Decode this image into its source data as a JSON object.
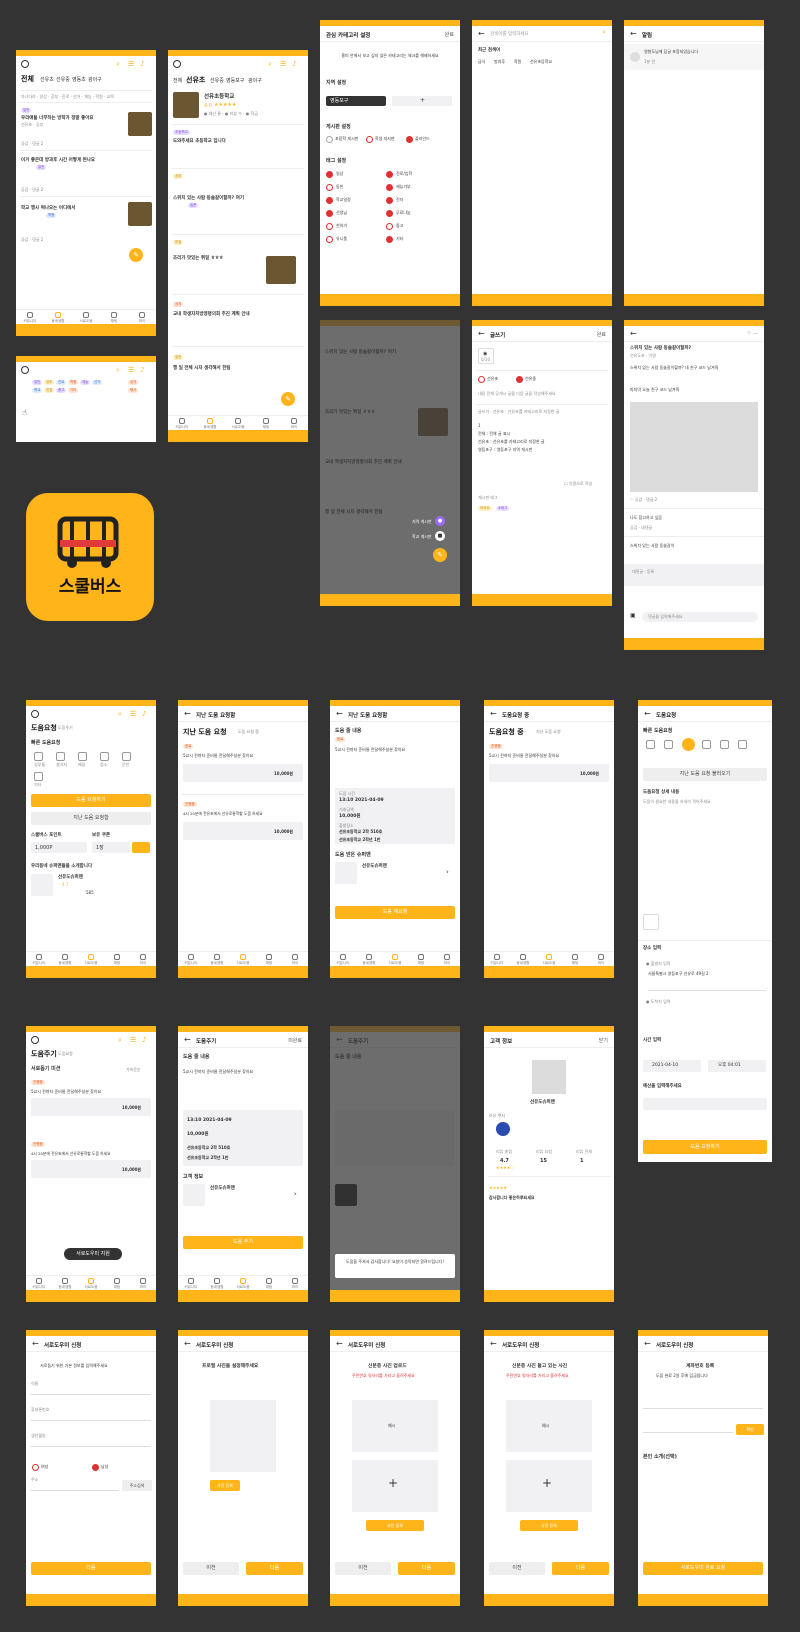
{
  "app": {
    "name": "스쿨버스",
    "accent": "#FFB41A",
    "background": "#333333"
  },
  "home": {
    "region_tabs": [
      "전체",
      "선유초",
      "선유중",
      "영동초",
      "광이구"
    ],
    "posts": [
      {
        "title": "우리애들 너무하는 방학가 정말 좋아요",
        "meta": "공감 · 댓글 2"
      },
      {
        "title": "이거 좋은데 방과후 시간 어떻게 된나요",
        "meta": "공감 · 댓글 2"
      },
      {
        "title": "학교 행사 떡나오는 어디에서",
        "meta": "공감 · 댓글 2"
      }
    ]
  },
  "school": {
    "tabs": [
      "전체",
      "선유초",
      "선유중",
      "영등포구",
      "광이구"
    ],
    "school_name": "선유초등학교",
    "rating": "4.0",
    "posts": [
      {
        "tag": "초등학교",
        "title": "도와주세요 초등학교 입니다"
      },
      {
        "tag": "공부",
        "title": "스위치 있는 사람 동솔갈이할까? 여기"
      },
      {
        "tag": "맛집",
        "title": "조리가 맛있는 튀일 ㅎㅎㅎ"
      },
      {
        "tag": "공지",
        "title": "교내 학생자치방영평의회 추진 계획 안내"
      },
      {
        "tag": "일반",
        "title": "행 일 전체 시자 생각해서 한팀"
      }
    ]
  },
  "category_settings": {
    "title": "관심 카테고리 설정",
    "done": "완료",
    "intro": "흥미 안에서 보고 싶지 않은 카테고리는 체크를 해제하세요",
    "region_label": "지역 설정",
    "region_value": "영등포구",
    "board_label": "게시판 설정",
    "boards": [
      "포함학 게시판",
      "학생 지사판",
      "플라인드"
    ],
    "tag_label": "태그 설정",
    "tags_left": [
      "일상",
      "동친",
      "학교일정",
      "선생님",
      "친하기",
      "유니폼"
    ],
    "tags_right": [
      "진로/입학",
      "재능기부",
      "진자",
      "무료나눔",
      "중고",
      "기타"
    ]
  },
  "search": {
    "placeholder": "검색어를 입력하세요",
    "recent_label": "최근 검색어",
    "recent": [
      "급식",
      "방과후",
      "학원",
      "선유초등학교"
    ]
  },
  "alarm": {
    "title": "알림",
    "item": "영향도님께 답글 포함되었습니다",
    "time": "1분 전"
  },
  "write": {
    "title": "글쓰기",
    "done": "완료",
    "photo_label": "0/10",
    "options": [
      "선유초",
      "선유중"
    ],
    "guide": "내용 전체 공개시 글을 다음 글을 작성해주세요"
  },
  "post_detail": {
    "title": "스위치 있는 사람 동솔갈이할까?",
    "body": "스위치 있는 사람 동솔갈이할까? 내 친구 코드 남겨줘",
    "comment": "마지막 오늘 친구 코드 남겨줘",
    "comment_placeholder": "댓글을 입력해주세요"
  },
  "help_request": {
    "title": "도움요청",
    "sub": "도움주기",
    "section": "빠른 도움요청",
    "categories": [
      "심부름",
      "설거지",
      "배달",
      "청소",
      "운반",
      "기타"
    ],
    "primary_button": "도움 요청하기",
    "secondary_button": "지난 도움 요청함",
    "point_label": "스쿨버스 포인트",
    "point_value": "1,000P",
    "coupon_label": "보유 쿠폰",
    "coupon_value": "1장",
    "helper_intro": "우리동네 슈퍼맨들을 소개합니다",
    "helper_name": "선유도슈퍼맨",
    "helper_rating": "4.7",
    "helper_count": "585"
  },
  "past_requests": {
    "title": "지난 도움 요청함",
    "tab": "지난 도움 요청",
    "sub": "도움 요청 중",
    "items": [
      {
        "status": "완료",
        "text": "5교시 전까지 준비물 전달해주실분 찾아요",
        "price": "10,000원"
      },
      {
        "status": "진행중",
        "text": "4시 20분에 전유초에서 선유로통학할 도움 하세요",
        "price": "10,000원"
      }
    ]
  },
  "help_detail": {
    "title": "도움요청",
    "content_label": "도움 줄 내용",
    "content": "5교시 전까지 준비물 전달해주실분 찾아요",
    "time_label": "도움 시간",
    "time_value": "13:10 2021-04-09",
    "price_label": "거래금액",
    "price_value": "10,000원",
    "place_label": "출발장소",
    "place_value": "선유초등학교 2학 510호",
    "dest_value": "선유초등학교 2학년 1반",
    "helper_label": "도움 받은 슈퍼맨",
    "confirm_button": "도움 재요청",
    "modal": "도움을 주셔서 감사합니다! 요청이 승락되면 알려드립니다!"
  },
  "help_ongoing": {
    "title": "도움요청 중",
    "sub": "지난 도움 요청"
  },
  "help_form": {
    "title": "도움요청",
    "section": "빠른 도움요청",
    "load_button": "지난 도움 요청 불러오기",
    "detail_label": "도움요청 상세 내용",
    "place_label": "장소 입력",
    "address": "서울특별시 영등포구 선유로 49길 2",
    "time_label": "시간 입력",
    "date_value": "2021-04-10",
    "time_value": "오후 04:01",
    "price_label": "예산을 입력해주세요",
    "submit": "도움 요청하기"
  },
  "giving": {
    "title": "도움주기",
    "sub": "도움요청",
    "mission": "서로돕기 미션",
    "filter": "가까운순",
    "register_button": "서로도우미 지원",
    "give_button": "도움 주기",
    "complete": "미완료"
  },
  "customer": {
    "title": "고객 정보",
    "close": "닫기",
    "name": "선유도슈퍼맨",
    "badge_label": "보유 뱃지",
    "stats_labels": [
      "리뷰 총점",
      "리뷰 요청",
      "리뷰 전체"
    ],
    "stats_values": [
      "4.7",
      "15",
      "1"
    ],
    "review": "감사합니다 좋은하루되세요"
  },
  "signup": {
    "title": "서로도우미 신청",
    "step1_intro": "서로돕기 위한 기본 정보를 입력해주세요",
    "fields": [
      "이름",
      "휴대폰번호",
      "생년월일",
      "주소"
    ],
    "gender": [
      "여성",
      "남성"
    ],
    "search_button": "주소검색",
    "next": "다음",
    "prev": "이전",
    "step2_title": "프로필 사진을 설정해주세요",
    "step2_button": "사진 등록",
    "step3_title": "신분증 사진 업로드",
    "step3_warn": "주민번호 뒷자리를 가리고 올려주세요",
    "step4_title": "신분증 사진 들고 있는 사진",
    "sample": "예시",
    "upload": "사진 등록",
    "step5_title": "계좌번호 등록",
    "step5_intro": "도움 완료 2일 후에 입금됩니다",
    "step5_button": "확인",
    "step5_self": "본인 소개(선택)",
    "step5_submit": "서로도우미 완료 요청"
  },
  "nav": [
    "커뮤니티",
    "동네생활",
    "서로도움",
    "채팅",
    "마이"
  ]
}
